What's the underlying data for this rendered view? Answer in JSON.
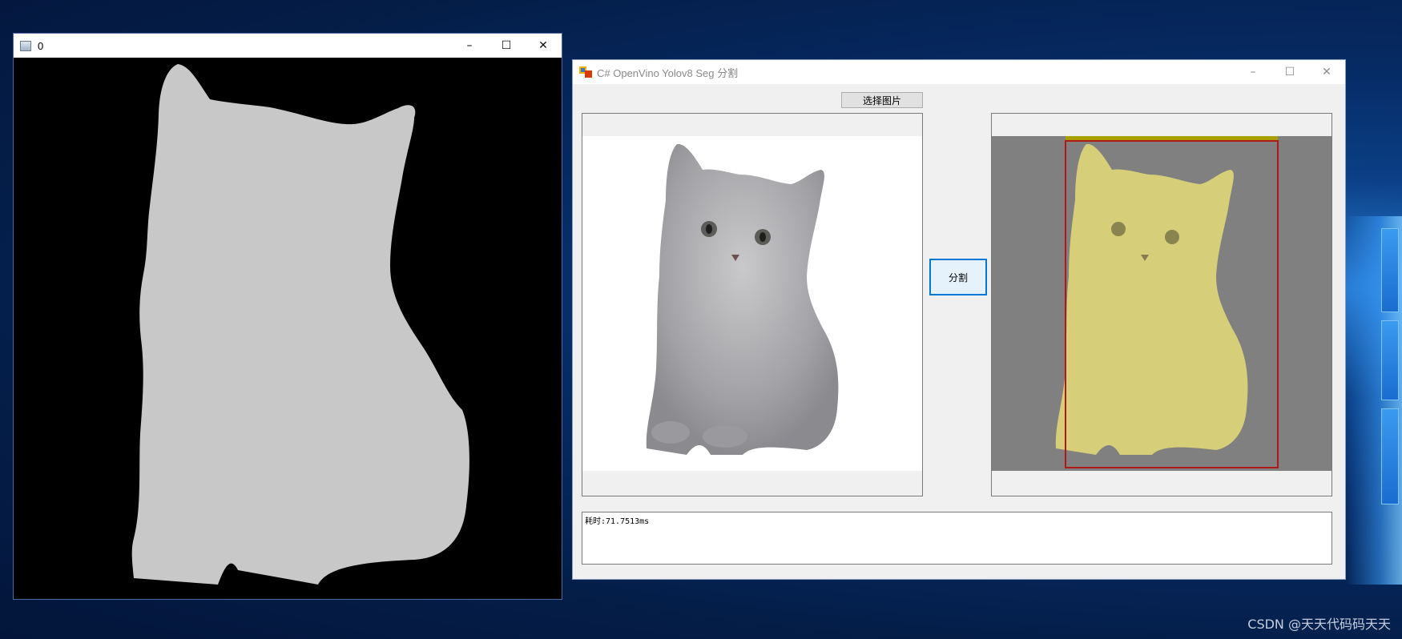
{
  "mask_window": {
    "title": "0",
    "controls": {
      "minimize": "–",
      "maximize": "☐",
      "close": "✕"
    }
  },
  "form_window": {
    "title": "C# OpenVino Yolov8 Seg 分割",
    "controls": {
      "minimize": "–",
      "maximize": "☐",
      "close": "✕"
    },
    "select_button_label": "选择图片",
    "segment_button_label": "分割",
    "result_text": "耗时:71.7513ms"
  },
  "watermark": "CSDN @天天代码码天天",
  "colors": {
    "mask_fill": "#c8c8c8",
    "overlay_yellow": "#d6ce78",
    "bbox_red": "#b01818",
    "accent_blue": "#0078d7"
  }
}
